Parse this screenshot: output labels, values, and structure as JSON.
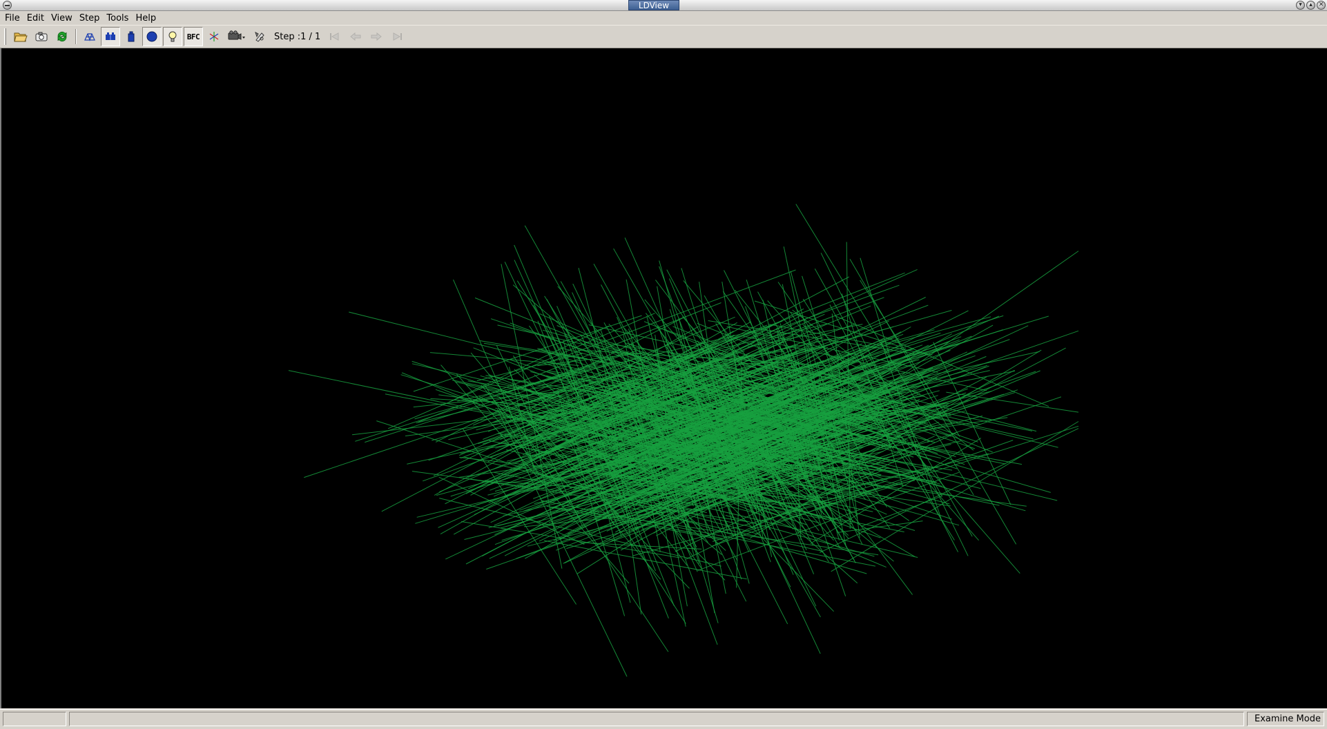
{
  "window": {
    "title": "LDView"
  },
  "menu": [
    {
      "key": "file",
      "label": "File"
    },
    {
      "key": "edit",
      "label": "Edit"
    },
    {
      "key": "view",
      "label": "View"
    },
    {
      "key": "step",
      "label": "Step"
    },
    {
      "key": "tools",
      "label": "Tools"
    },
    {
      "key": "help",
      "label": "Help"
    }
  ],
  "toolbar": {
    "step_label": "Step :1 / 1",
    "bfc_label": "BFC",
    "buttons": [
      {
        "name": "open",
        "icon": "open-folder-icon"
      },
      {
        "name": "screenshot",
        "icon": "camera-icon"
      },
      {
        "name": "reload",
        "icon": "reload-icon"
      },
      {
        "name": "wireframe",
        "icon": "wireframe-icon"
      },
      {
        "name": "seams",
        "icon": "seams-icon",
        "toggled": true
      },
      {
        "name": "edges",
        "icon": "edges-icon"
      },
      {
        "name": "primitive-substitution",
        "icon": "primitive-substitution-icon",
        "toggled": true
      },
      {
        "name": "lighting",
        "icon": "lightbulb-icon",
        "toggled": true
      },
      {
        "name": "bfc",
        "icon": "bfc-icon",
        "toggled": true
      },
      {
        "name": "show-axes",
        "icon": "axes-icon"
      },
      {
        "name": "view-angle",
        "icon": "camera-angle-icon"
      },
      {
        "name": "preferences",
        "icon": "preferences-icon"
      }
    ],
    "nav": [
      "first-step-icon",
      "previous-step-icon",
      "next-step-icon",
      "last-step-icon"
    ]
  },
  "viewport": {
    "background": "#000000",
    "line_color": "#18a040"
  },
  "statusbar": {
    "progress": "",
    "message": "",
    "mode": "Examine Mode"
  },
  "colors": {
    "chrome": "#d6d2cb",
    "title_active": "#3d5f92",
    "icon_blue": "#1d3fb0",
    "icon_green": "#1fa02a",
    "icon_yellow": "#f0c020"
  }
}
